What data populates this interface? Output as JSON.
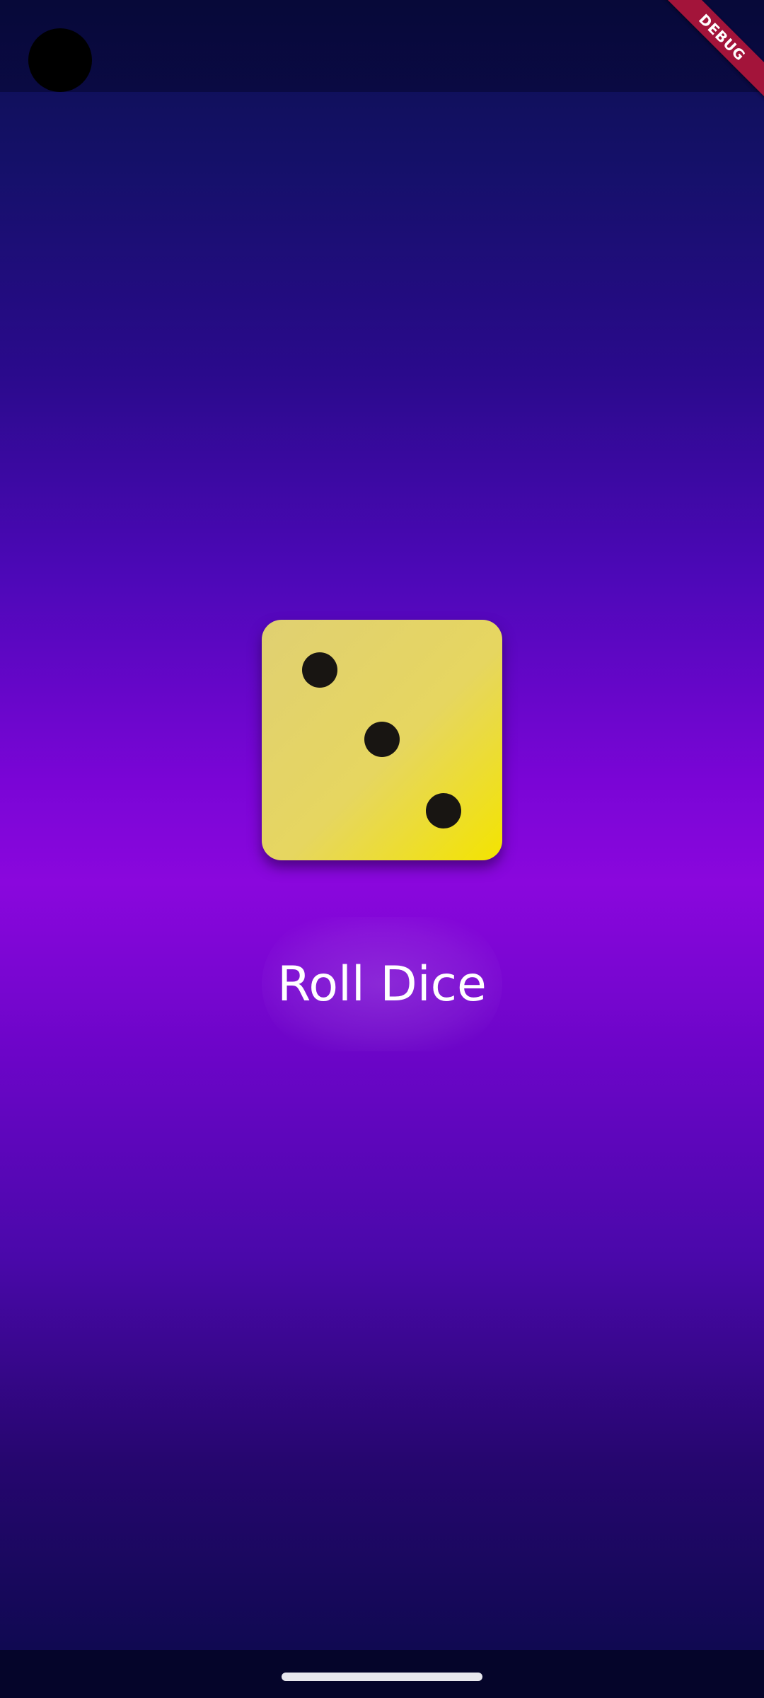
{
  "app": {
    "debug_banner": "DEBUG"
  },
  "die": {
    "face_value": 3,
    "color": "#e6d660",
    "pip_color": "#181512"
  },
  "actions": {
    "roll_label": "Roll Dice"
  },
  "theme": {
    "gradient_top": "#0b0f4d",
    "gradient_mid": "#8a07dd",
    "gradient_bottom": "#0a0a4a"
  },
  "icons": {
    "status": "camera-cutout-icon",
    "home": "home-indicator-icon"
  }
}
